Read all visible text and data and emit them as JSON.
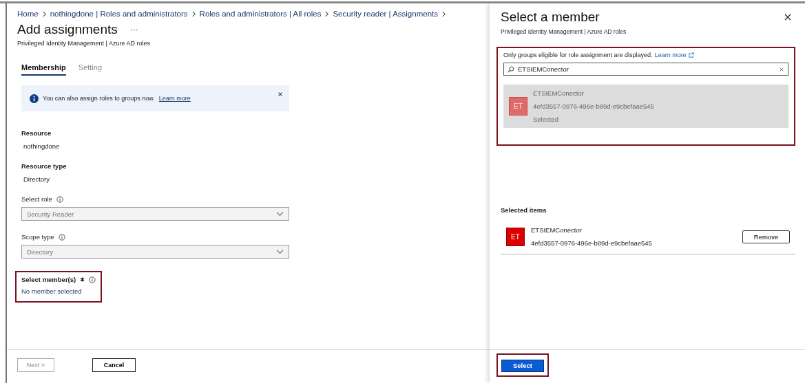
{
  "breadcrumb": [
    "Home",
    "nothingdone | Roles and administrators",
    "Roles and administrators | All roles",
    "Security reader | Assignments"
  ],
  "page": {
    "title": "Add assignments",
    "more": "···",
    "subtitle": "Privileged Identity Management | Azure AD roles"
  },
  "tabs": [
    {
      "label": "Membership",
      "selected": true
    },
    {
      "label": "Setting",
      "selected": false
    }
  ],
  "info_banner": {
    "text": "You can also assign roles to groups now.",
    "link": "Learn more"
  },
  "fields": [
    {
      "kind": "static",
      "label": "Resource",
      "value": "nothingdone"
    },
    {
      "kind": "static",
      "label": "Resource type",
      "value": "Directory"
    },
    {
      "kind": "dropdown",
      "label": "Select role",
      "value": "Security Reader",
      "disabled": true
    },
    {
      "kind": "dropdown",
      "label": "Scope type",
      "value": "Directory",
      "disabled": true
    },
    {
      "kind": "members",
      "label": "Select member(s)",
      "required": true,
      "value": "No member selected"
    }
  ],
  "footer_buttons": [
    {
      "label": "Next >",
      "disabled": true
    },
    {
      "label": "Cancel",
      "disabled": false
    }
  ],
  "panel": {
    "title": "Select a member",
    "subtitle": "Privileged Identity Management | Azure AD roles",
    "notice": "Only groups eligible for role assignment are displayed.",
    "notice_link": "Learn more",
    "search": {
      "value": "ETSIEMConector"
    },
    "results": [
      {
        "initials": "ET",
        "name": "ETSIEMConector",
        "id": "4efd3557-0976-496e-b89d-e9cbefaae545",
        "status": "Selected",
        "selected": true
      }
    ],
    "selected_heading": "Selected items",
    "selected_items": [
      {
        "initials": "ET",
        "name": "ETSIEMConector",
        "id": "4efd3557-0976-496e-b89d-e9cbefaae545",
        "action": "Remove"
      }
    ],
    "primary_button": "Select"
  }
}
